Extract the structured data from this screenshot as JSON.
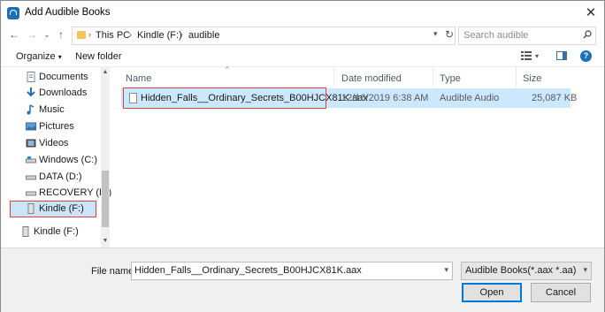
{
  "window": {
    "title": "Add Audible Books",
    "close_glyph": "✕"
  },
  "nav": {
    "back_glyph": "←",
    "forward_glyph": "→",
    "recent_glyph": "⌄",
    "up_glyph": "↑",
    "breadcrumb": [
      "This PC",
      "Kindle (F:)",
      "audible"
    ],
    "sep_glyph": "›",
    "refresh_glyph": "↻",
    "search_placeholder": "Search audible"
  },
  "toolbar": {
    "organize_label": "Organize",
    "new_folder_label": "New folder",
    "help_glyph": "?"
  },
  "sidebar": {
    "items": [
      {
        "label": "Documents",
        "icon": "documents-icon"
      },
      {
        "label": "Downloads",
        "icon": "downloads-icon"
      },
      {
        "label": "Music",
        "icon": "music-icon"
      },
      {
        "label": "Pictures",
        "icon": "pictures-icon"
      },
      {
        "label": "Videos",
        "icon": "videos-icon"
      },
      {
        "label": "Windows (C:)",
        "icon": "drive-icon"
      },
      {
        "label": "DATA (D:)",
        "icon": "drive-icon"
      },
      {
        "label": "RECOVERY (E:)",
        "icon": "drive-icon"
      },
      {
        "label": "Kindle (F:)",
        "icon": "usb-drive-icon",
        "selected": true
      },
      {
        "label": "Kindle (F:)",
        "icon": "usb-drive-icon"
      }
    ]
  },
  "columns": [
    "Name",
    "Date modified",
    "Type",
    "Size"
  ],
  "files": [
    {
      "name": "Hidden_Falls__Ordinary_Secrets_B00HJCX81K.aax",
      "date": "12/16/2019 6:38 AM",
      "type": "Audible Audio",
      "size": "25,087 KB",
      "selected": true
    }
  ],
  "footer": {
    "file_name_label": "File name:",
    "file_name_value": "Hidden_Falls__Ordinary_Secrets_B00HJCX81K.aax",
    "filter_value": "Audible Books(*.aax *.aa)",
    "open_label": "Open",
    "cancel_label": "Cancel"
  },
  "colors": {
    "accent": "#0078d7",
    "selection": "#cce8ff",
    "annotation_red": "#e04040"
  }
}
